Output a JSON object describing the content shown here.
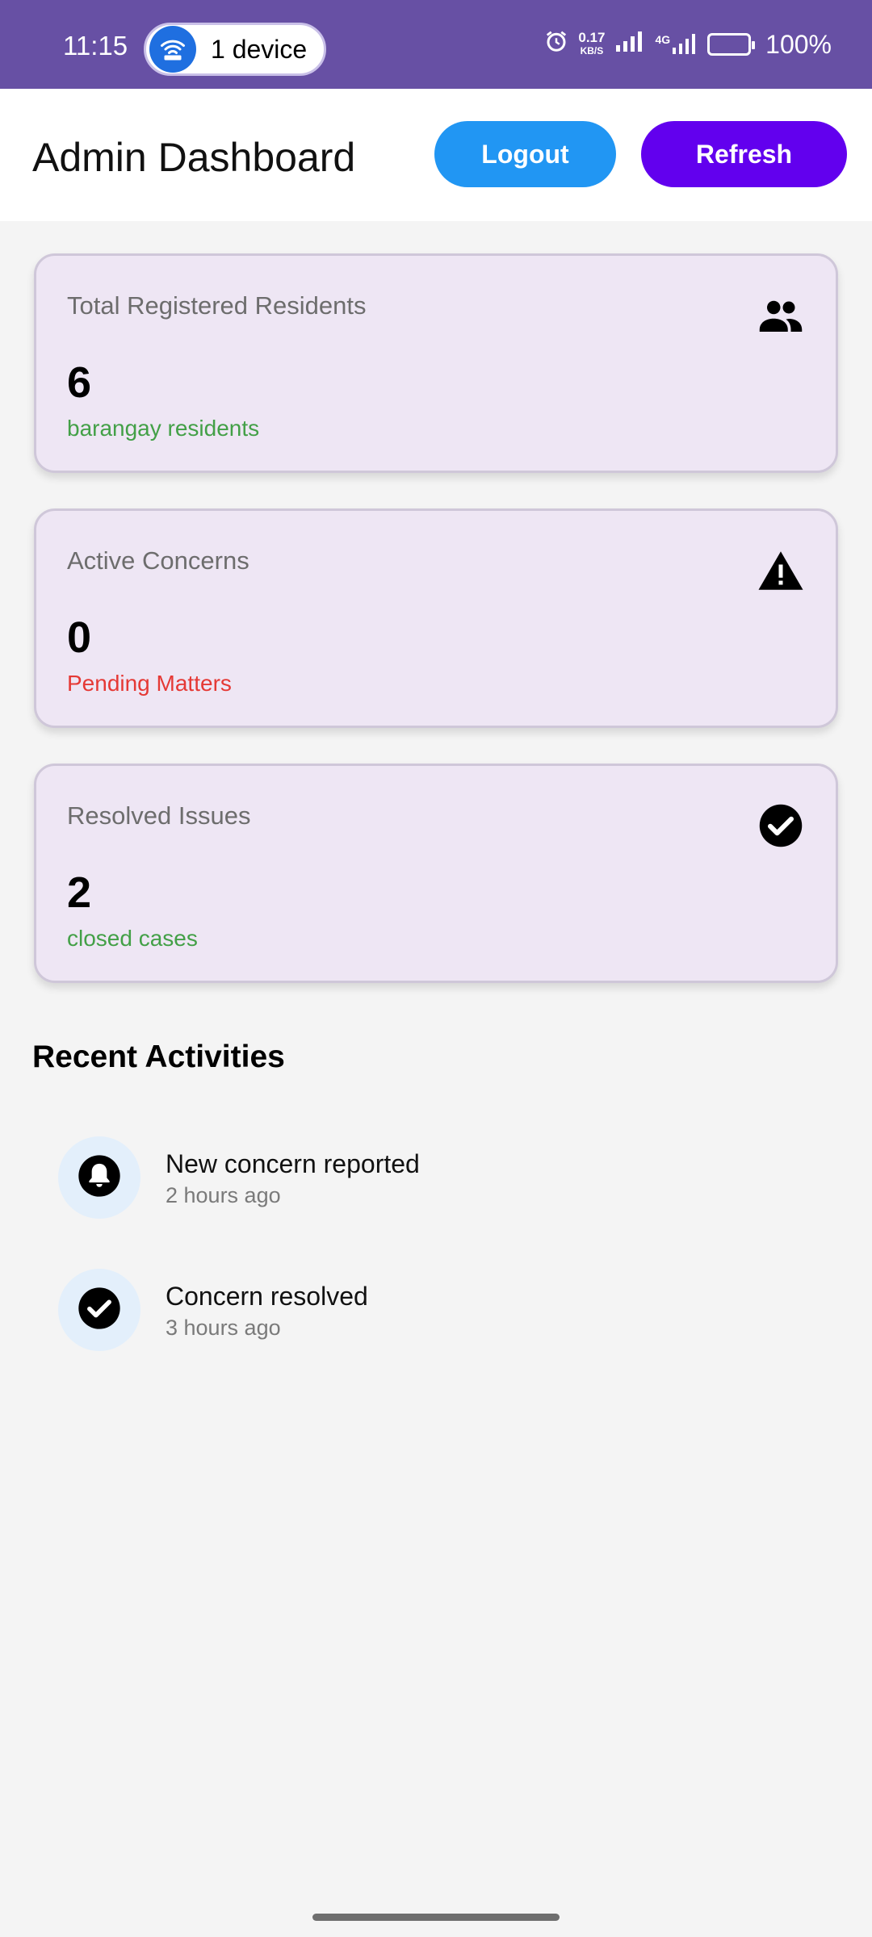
{
  "status_bar": {
    "time": "11:15",
    "hotspot_label": "1 device",
    "net_speed_value": "0.17",
    "net_speed_unit": "KB/S",
    "network_type": "4G",
    "battery": "100%"
  },
  "header": {
    "title": "Admin Dashboard",
    "logout_label": "Logout",
    "refresh_label": "Refresh"
  },
  "cards": [
    {
      "title": "Total Registered Residents",
      "value": "6",
      "subtitle": "barangay residents",
      "icon": "people-icon"
    },
    {
      "title": "Active Concerns",
      "value": "0",
      "subtitle": "Pending Matters",
      "icon": "warning-icon"
    },
    {
      "title": "Resolved Issues",
      "value": "2",
      "subtitle": "closed cases",
      "icon": "check-circle-icon"
    }
  ],
  "recent": {
    "title": "Recent Activities",
    "items": [
      {
        "title": "New concern reported",
        "time": "2 hours ago",
        "icon": "bell-icon"
      },
      {
        "title": "Concern resolved",
        "time": "3 hours ago",
        "icon": "check-circle-icon"
      }
    ]
  },
  "colors": {
    "status_bar": "#6750a4",
    "logout_button": "#2196f3",
    "refresh_button": "#6200ee",
    "card_background": "#eee6f4",
    "positive_text": "#43a047",
    "negative_text": "#e53935"
  }
}
